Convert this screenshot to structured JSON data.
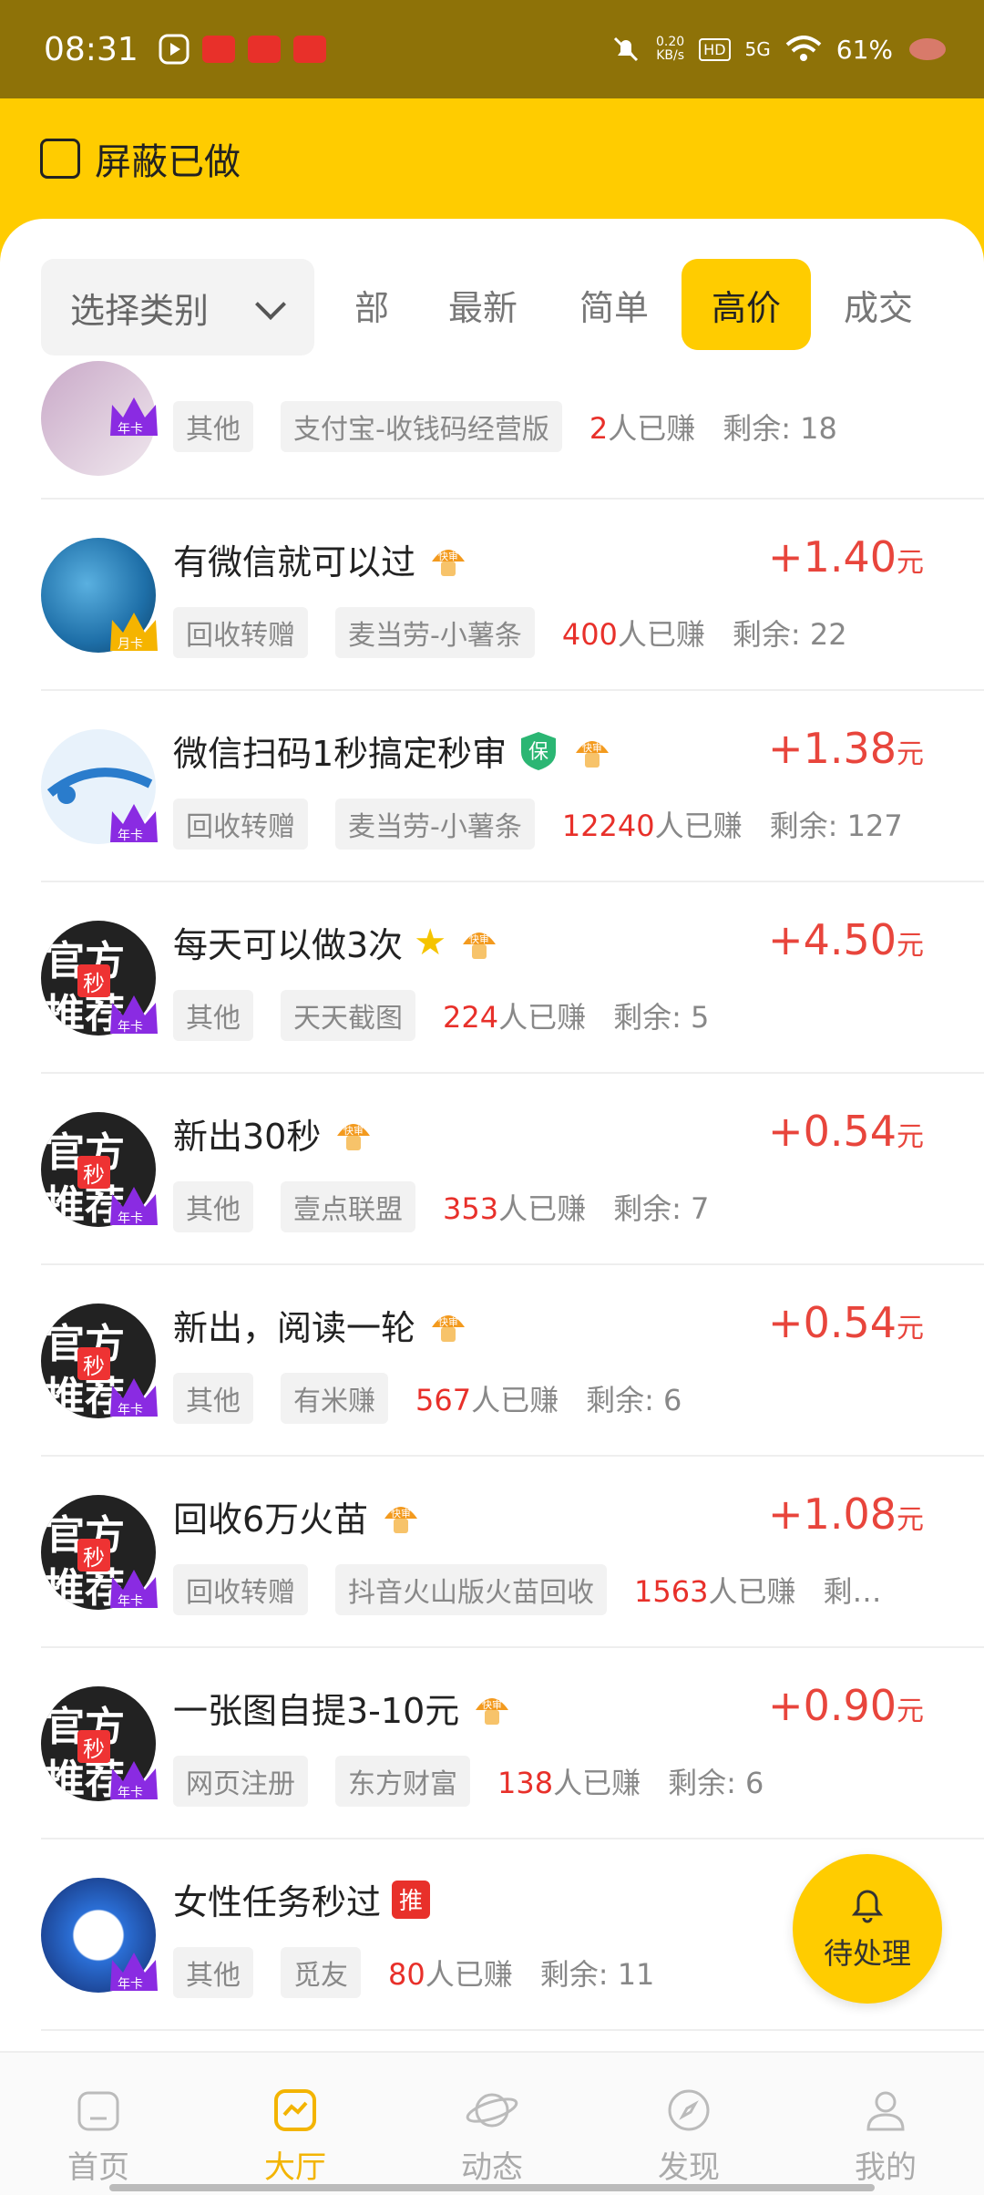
{
  "status_bar": {
    "time": "08:31",
    "net_speed": "0.20",
    "net_unit": "KB/s",
    "hd": "HD",
    "net_type": "5G",
    "battery": "61%"
  },
  "filter": {
    "hide_done_label": "屏蔽已做"
  },
  "category": {
    "label": "选择类别"
  },
  "tabs": [
    "部",
    "最新",
    "简单",
    "高价",
    "成交"
  ],
  "active_tab": "高价",
  "colors": {
    "accent": "#ffcc00",
    "price": "#e8453c",
    "statusbar": "#8e7208"
  },
  "tasks": [
    {
      "title": "",
      "price": "",
      "unit": "",
      "category": "其他",
      "platform": "支付宝-收钱码经营版",
      "earned": "2",
      "earned_suffix": "人已赚",
      "remaining": "剩余: 18",
      "avatar": "photo",
      "card": "年卡"
    },
    {
      "title": "有微信就可以过",
      "badges": [
        "快审"
      ],
      "price": "+1.40",
      "unit": "元",
      "category": "回收转赠",
      "platform": "麦当劳-小薯条",
      "earned": "400",
      "earned_suffix": "人已赚",
      "remaining": "剩余: 22",
      "avatar": "photo",
      "card": "月卡"
    },
    {
      "title": "微信扫码1秒搞定秒审",
      "badges": [
        "保",
        "快审"
      ],
      "price": "+1.38",
      "unit": "元",
      "category": "回收转赠",
      "platform": "麦当劳-小薯条",
      "earned": "12240",
      "earned_suffix": "人已赚",
      "remaining": "剩余: 127",
      "avatar": "logo",
      "card": "年卡"
    },
    {
      "title": "每天可以做3次",
      "badges": [
        "star",
        "快审"
      ],
      "price": "+4.50",
      "unit": "元",
      "category": "其他",
      "platform": "天天截图",
      "earned": "224",
      "earned_suffix": "人已赚",
      "remaining": "剩余: 5",
      "avatar": "official",
      "card": "年卡"
    },
    {
      "title": "新出30秒",
      "badges": [
        "快审"
      ],
      "price": "+0.54",
      "unit": "元",
      "category": "其他",
      "platform": "壹点联盟",
      "earned": "353",
      "earned_suffix": "人已赚",
      "remaining": "剩余: 7",
      "avatar": "official",
      "card": "年卡"
    },
    {
      "title": "新出，阅读一轮",
      "badges": [
        "快审"
      ],
      "price": "+0.54",
      "unit": "元",
      "category": "其他",
      "platform": "有米赚",
      "earned": "567",
      "earned_suffix": "人已赚",
      "remaining": "剩余: 6",
      "avatar": "official",
      "card": "年卡"
    },
    {
      "title": "回收6万火苗",
      "badges": [
        "快审"
      ],
      "price": "+1.08",
      "unit": "元",
      "category": "回收转赠",
      "platform": "抖音火山版火苗回收",
      "earned": "1563",
      "earned_suffix": "人已赚",
      "remaining": "剩…",
      "avatar": "official",
      "card": "年卡"
    },
    {
      "title": "一张图自提3-10元",
      "badges": [
        "快审"
      ],
      "price": "+0.90",
      "unit": "元",
      "category": "网页注册",
      "platform": "东方财富",
      "earned": "138",
      "earned_suffix": "人已赚",
      "remaining": "剩余: 6",
      "avatar": "official",
      "card": "年卡"
    },
    {
      "title": "女性任务秒过",
      "badges": [
        "推"
      ],
      "price": "+1",
      "unit": "",
      "category": "其他",
      "platform": "觅友",
      "earned": "80",
      "earned_suffix": "人已赚",
      "remaining": "剩余: 11",
      "avatar": "cartoon",
      "card": "年卡"
    }
  ],
  "avatar_official": {
    "line1": "官方",
    "line2": "推荐",
    "miao": "秒"
  },
  "fast_badge_text": "快审",
  "fab": {
    "label": "待处理"
  },
  "nav": [
    {
      "label": "首页",
      "icon": "home-icon"
    },
    {
      "label": "大厅",
      "icon": "hall-icon"
    },
    {
      "label": "动态",
      "icon": "planet-icon"
    },
    {
      "label": "发现",
      "icon": "compass-icon"
    },
    {
      "label": "我的",
      "icon": "profile-icon"
    }
  ],
  "active_nav": "大厅"
}
